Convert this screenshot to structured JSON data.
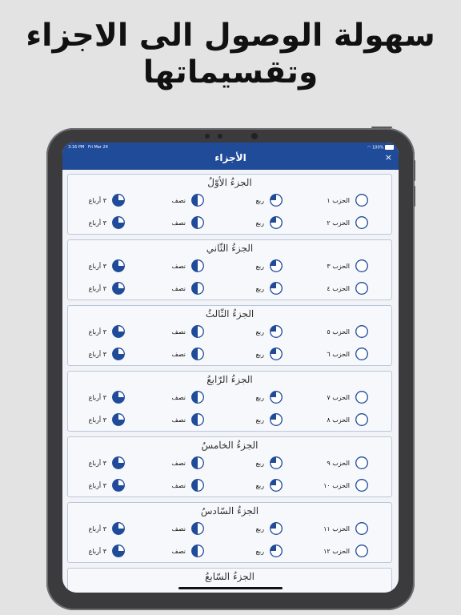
{
  "headline": {
    "line1": "سهولة الوصول الى الاجزاء",
    "line2": "وتقسيماتها"
  },
  "status_bar": {
    "time": "3:16 PM",
    "date": "Fri Mar 24",
    "battery": "100%"
  },
  "nav": {
    "title": "الأجزاء",
    "close": "×"
  },
  "colors": {
    "accent": "#1f4b99",
    "card_border": "#b9c7dd",
    "background": "#e3e3e3"
  },
  "icons": [
    "hizb-circle-icon",
    "quarter-pie-icon",
    "half-pie-icon",
    "three-quarter-pie-icon",
    "close-icon"
  ],
  "juz": [
    {
      "title": "الجزءُ الأوّلُ",
      "rows": [
        {
          "hizb": "الحزب ١",
          "rub": "ربع",
          "nisf": "نصف",
          "three": "٣ أرباع"
        },
        {
          "hizb": "الحزب ٢",
          "rub": "ربع",
          "nisf": "نصف",
          "three": "٣ أرباع"
        }
      ]
    },
    {
      "title": "الجزءُ الثّاني",
      "rows": [
        {
          "hizb": "الحزب ٣",
          "rub": "ربع",
          "nisf": "نصف",
          "three": "٣ أرباع"
        },
        {
          "hizb": "الحزب ٤",
          "rub": "ربع",
          "nisf": "نصف",
          "three": "٣ أرباع"
        }
      ]
    },
    {
      "title": "الجزءُ الثّالثُ",
      "rows": [
        {
          "hizb": "الحزب ٥",
          "rub": "ربع",
          "nisf": "نصف",
          "three": "٣ أرباع"
        },
        {
          "hizb": "الحزب ٦",
          "rub": "ربع",
          "nisf": "نصف",
          "three": "٣ أرباع"
        }
      ]
    },
    {
      "title": "الجزءُ الرّابعُ",
      "rows": [
        {
          "hizb": "الحزب ٧",
          "rub": "ربع",
          "nisf": "نصف",
          "three": "٣ أرباع"
        },
        {
          "hizb": "الحزب ٨",
          "rub": "ربع",
          "nisf": "نصف",
          "three": "٣ أرباع"
        }
      ]
    },
    {
      "title": "الجزءُ الخامسُ",
      "rows": [
        {
          "hizb": "الحزب ٩",
          "rub": "ربع",
          "nisf": "نصف",
          "three": "٣ أرباع"
        },
        {
          "hizb": "الحزب ١٠",
          "rub": "ربع",
          "nisf": "نصف",
          "three": "٣ أرباع"
        }
      ]
    },
    {
      "title": "الجزءُ السّادسُ",
      "rows": [
        {
          "hizb": "الحزب ١١",
          "rub": "ربع",
          "nisf": "نصف",
          "three": "٣ أرباع"
        },
        {
          "hizb": "الحزب ١٢",
          "rub": "ربع",
          "nisf": "نصف",
          "three": "٣ أرباع"
        }
      ]
    },
    {
      "title": "الجزءُ السّابعُ",
      "rows": []
    }
  ]
}
